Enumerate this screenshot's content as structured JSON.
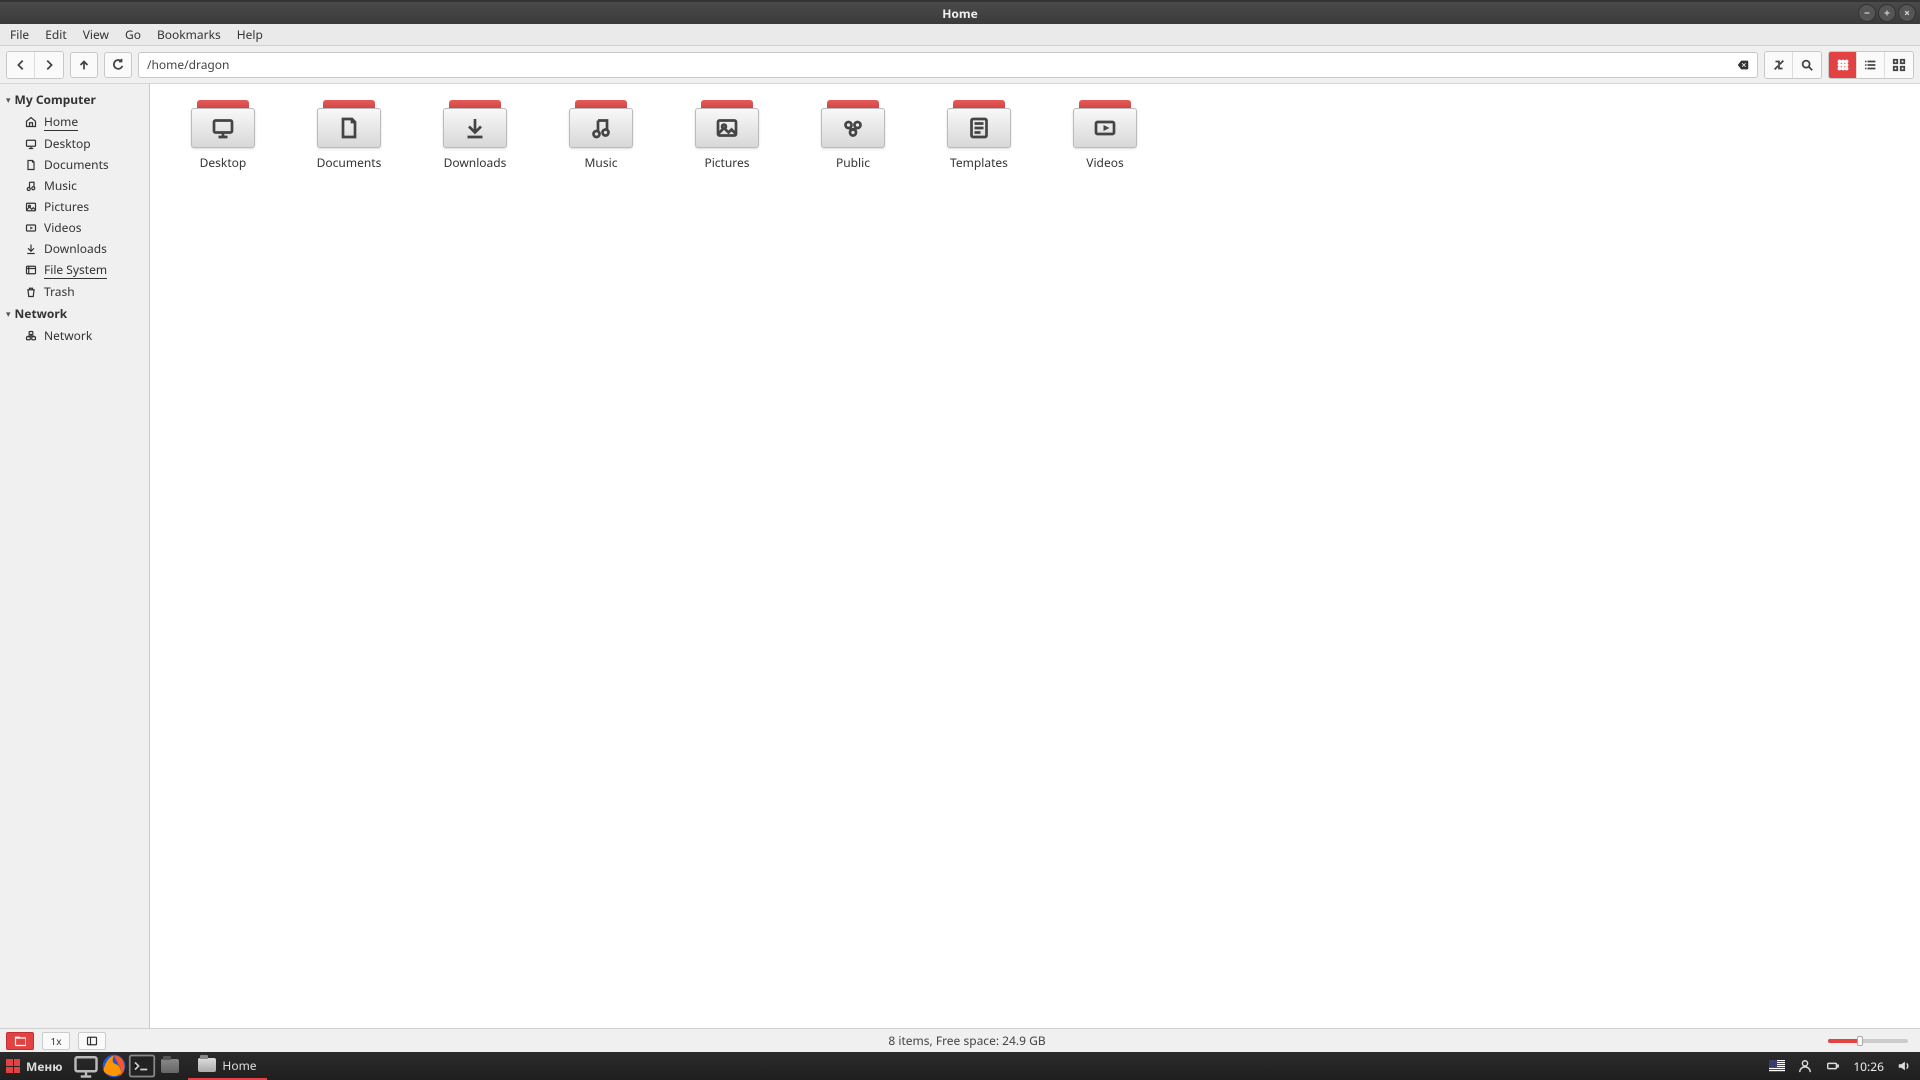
{
  "window": {
    "title": "Home"
  },
  "menubar": [
    "File",
    "Edit",
    "View",
    "Go",
    "Bookmarks",
    "Help"
  ],
  "path": "/home/dragon",
  "sidebar": {
    "groups": [
      {
        "label": "My Computer",
        "items": [
          {
            "icon": "home",
            "label": "Home",
            "active": true
          },
          {
            "icon": "desktop",
            "label": "Desktop"
          },
          {
            "icon": "document",
            "label": "Documents"
          },
          {
            "icon": "music",
            "label": "Music"
          },
          {
            "icon": "pictures",
            "label": "Pictures"
          },
          {
            "icon": "videos",
            "label": "Videos"
          },
          {
            "icon": "downloads",
            "label": "Downloads"
          },
          {
            "icon": "filesystem",
            "label": "File System",
            "underlined": true
          },
          {
            "icon": "trash",
            "label": "Trash"
          }
        ]
      },
      {
        "label": "Network",
        "items": [
          {
            "icon": "network",
            "label": "Network"
          }
        ]
      }
    ]
  },
  "folders": [
    {
      "icon": "desktop",
      "label": "Desktop"
    },
    {
      "icon": "document",
      "label": "Documents"
    },
    {
      "icon": "downloads",
      "label": "Downloads"
    },
    {
      "icon": "music",
      "label": "Music"
    },
    {
      "icon": "pictures",
      "label": "Pictures"
    },
    {
      "icon": "public",
      "label": "Public"
    },
    {
      "icon": "templates",
      "label": "Templates"
    },
    {
      "icon": "videos",
      "label": "Videos"
    }
  ],
  "statusbar": {
    "zoom": "1x",
    "text": "8 items, Free space: 24.9 GB"
  },
  "taskbar": {
    "menu_label": "Меню",
    "window_label": "Home",
    "clock": "10:26"
  }
}
